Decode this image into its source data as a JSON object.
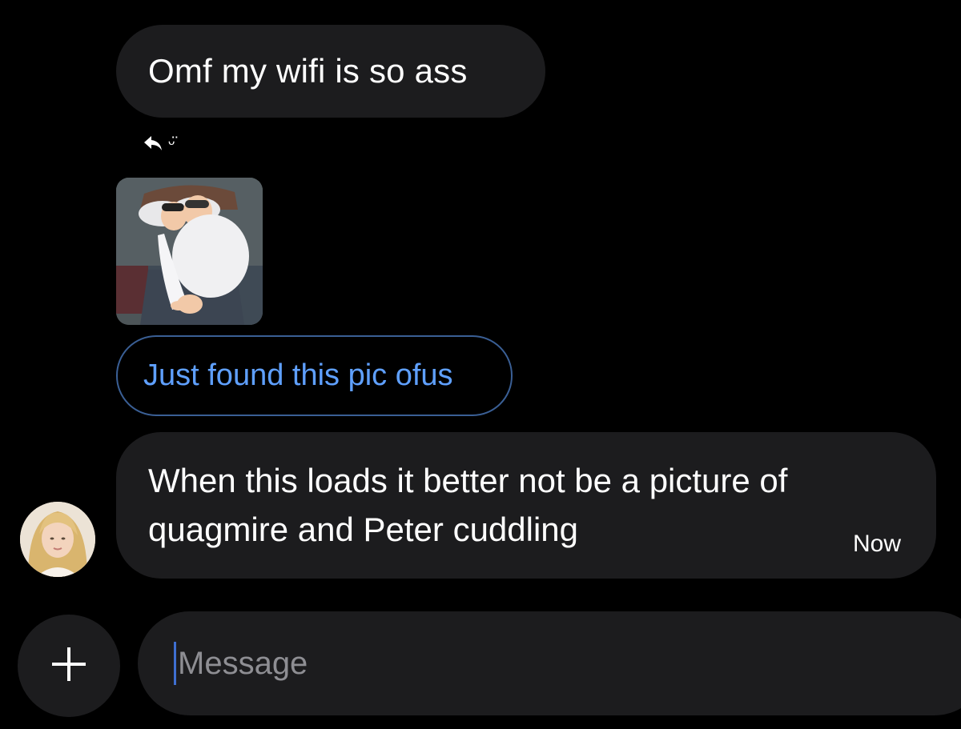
{
  "conversation": {
    "messages": [
      {
        "text": "Omf my wifi is so ass"
      },
      {
        "reply_smiley": "ᵕ̈"
      },
      {
        "text": "Just found this pic ofus"
      },
      {
        "text": "When this loads it better not be a picture of quagmire and Peter cuddling",
        "time": "Now"
      }
    ]
  },
  "composer": {
    "placeholder": "Message",
    "value": ""
  },
  "colors": {
    "background": "#000000",
    "bubble": "#1c1c1e",
    "outline": "#3a5f95",
    "link_text": "#5fa0ff",
    "placeholder": "#8e8e93",
    "caret": "#3f6fd1"
  },
  "icons": {
    "reply": "reply-arrow-icon",
    "plus": "plus-icon"
  }
}
